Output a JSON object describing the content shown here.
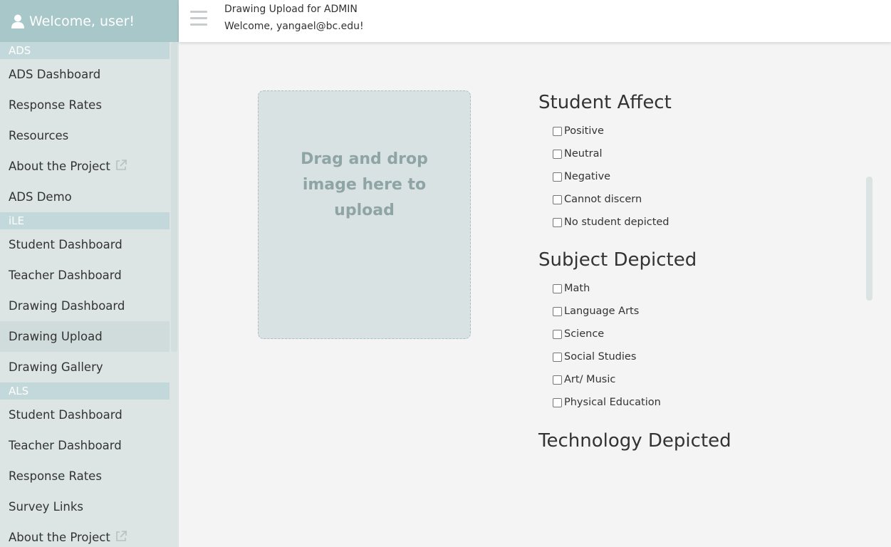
{
  "sidebar": {
    "welcome": "Welcome, user!",
    "sections": [
      {
        "title": "ADS",
        "items": [
          {
            "label": "ADS Dashboard",
            "external": false
          },
          {
            "label": "Response Rates",
            "external": false
          },
          {
            "label": "Resources",
            "external": false
          },
          {
            "label": "About the Project",
            "external": true
          },
          {
            "label": "ADS Demo",
            "external": false
          }
        ]
      },
      {
        "title": "iLE",
        "items": [
          {
            "label": "Student Dashboard",
            "external": false
          },
          {
            "label": "Teacher Dashboard",
            "external": false
          },
          {
            "label": "Drawing Dashboard",
            "external": false
          },
          {
            "label": "Drawing Upload",
            "external": false,
            "active": true
          },
          {
            "label": "Drawing Gallery",
            "external": false
          }
        ]
      },
      {
        "title": "ALS",
        "items": [
          {
            "label": "Student Dashboard",
            "external": false
          },
          {
            "label": "Teacher Dashboard",
            "external": false
          },
          {
            "label": "Response Rates",
            "external": false
          },
          {
            "label": "Survey Links",
            "external": false
          },
          {
            "label": "About the Project",
            "external": true
          }
        ]
      }
    ]
  },
  "header": {
    "title": "Drawing Upload for ADMIN",
    "welcome": "Welcome, yangael@bc.edu!"
  },
  "dropzone": {
    "text": "Drag and drop image here to upload"
  },
  "form": {
    "student_affect": {
      "title": "Student Affect",
      "options": [
        "Positive",
        "Neutral",
        "Negative",
        "Cannot discern",
        "No student depicted"
      ]
    },
    "subject_depicted": {
      "title": "Subject Depicted",
      "options": [
        "Math",
        "Language Arts",
        "Science",
        "Social Studies",
        "Art/ Music",
        "Physical Education"
      ]
    },
    "technology_depicted": {
      "title": "Technology Depicted"
    }
  },
  "colors": {
    "sidebar_bg": "#dce5e4",
    "sidebar_header": "#a8c7c9",
    "section_header": "#c3d8da",
    "dropzone_bg": "#d9e2e2",
    "dropzone_text": "#8fa4a5"
  }
}
